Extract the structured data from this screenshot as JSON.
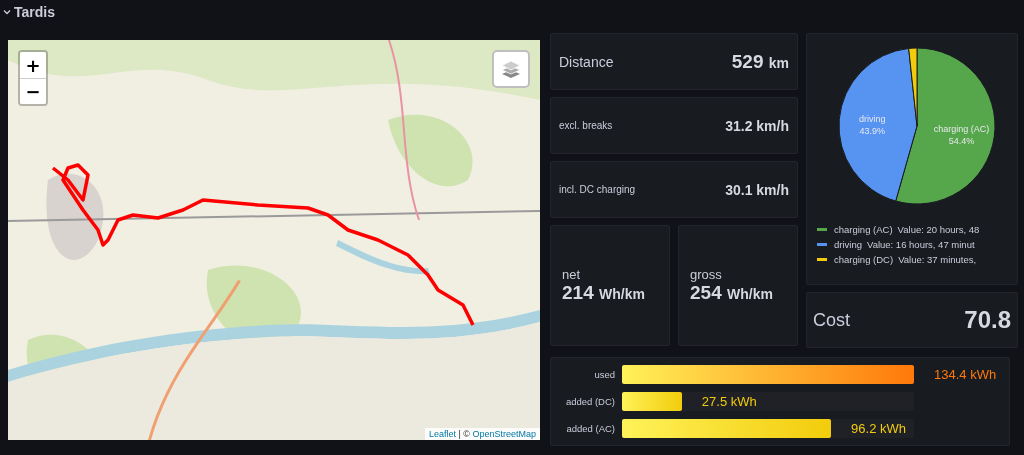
{
  "row": {
    "title": "Tardis",
    "expanded": true
  },
  "map": {
    "kind": "picture",
    "zoom_in": "+",
    "zoom_out": "−",
    "attribution": {
      "link1": "Leaflet",
      "separator": "| ©",
      "link2": "OpenStreetMap"
    }
  },
  "distance": {
    "label": "Distance",
    "value": "529",
    "unit": "km"
  },
  "speeds": [
    {
      "label": "excl. breaks",
      "value": "31.2 km/h"
    },
    {
      "label": "incl. DC charging",
      "value": "30.1 km/h"
    }
  ],
  "consumption": [
    {
      "label": "net",
      "value": "214",
      "unit": "Wh/km"
    },
    {
      "label": "gross",
      "value": "254",
      "unit": "Wh/km"
    }
  ],
  "time_split": {
    "chart_data": {
      "type": "pie",
      "categories": [
        "charging (AC)",
        "driving",
        "charging (DC)"
      ],
      "values": [
        54.4,
        43.9,
        1.7
      ],
      "annotations": [
        {
          "x": "charging (AC)",
          "text": "54.4%"
        },
        {
          "x": "driving",
          "text": "43.9%"
        }
      ],
      "legend": "bottom"
    },
    "legend": [
      {
        "value": "Value: 20 hours, 48",
        "color": "#56a64b"
      },
      {
        "value": "Value: 16 hours, 47 minut",
        "color": "#5794f2"
      },
      {
        "value": "Value: 37 minutes,",
        "color": "#f2cc0c"
      }
    ]
  },
  "cost": {
    "label": "Cost",
    "value": "70.8"
  },
  "energy": [
    {
      "label": "used",
      "level": 1.0,
      "value": "134.4 kWh",
      "color": "#ff780a"
    },
    {
      "label": "added (DC)",
      "level": 0.205,
      "value": "27.5 kWh",
      "color": "#f2cc0c"
    },
    {
      "label": "added (AC)",
      "level": 0.716,
      "value": "96.2 kWh",
      "color": "#f2cc0c"
    }
  ]
}
